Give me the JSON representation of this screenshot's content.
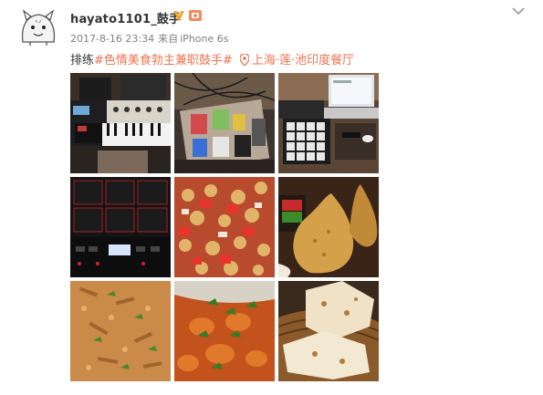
{
  "post": {
    "username": "hayato1101_鼓手",
    "date": "2017-8-16 23:34",
    "source_prefix": "来自",
    "source": "iPhone 6s",
    "text_prefix": "排练",
    "hashtag": "#色情美食勃主兼职鼓手#",
    "location": "上海·莲·池印度餐厅"
  },
  "icons": {
    "verified": "verified-v-icon",
    "medal": "medal-icon",
    "menu": "chevron-down-icon",
    "location": "location-pin-icon"
  },
  "colors": {
    "accent": "#eb7350",
    "verified": "#f5a623",
    "text": "#333333",
    "meta": "#808080"
  },
  "photos": [
    {
      "subject": "synthesizer-keyboard"
    },
    {
      "subject": "guitar-pedalboard"
    },
    {
      "subject": "laptop-launchpad"
    },
    {
      "subject": "drum-sample-pad"
    },
    {
      "subject": "chickpea-salad"
    },
    {
      "subject": "samosas"
    },
    {
      "subject": "biryani-rice"
    },
    {
      "subject": "curry"
    },
    {
      "subject": "naan-bread"
    }
  ]
}
